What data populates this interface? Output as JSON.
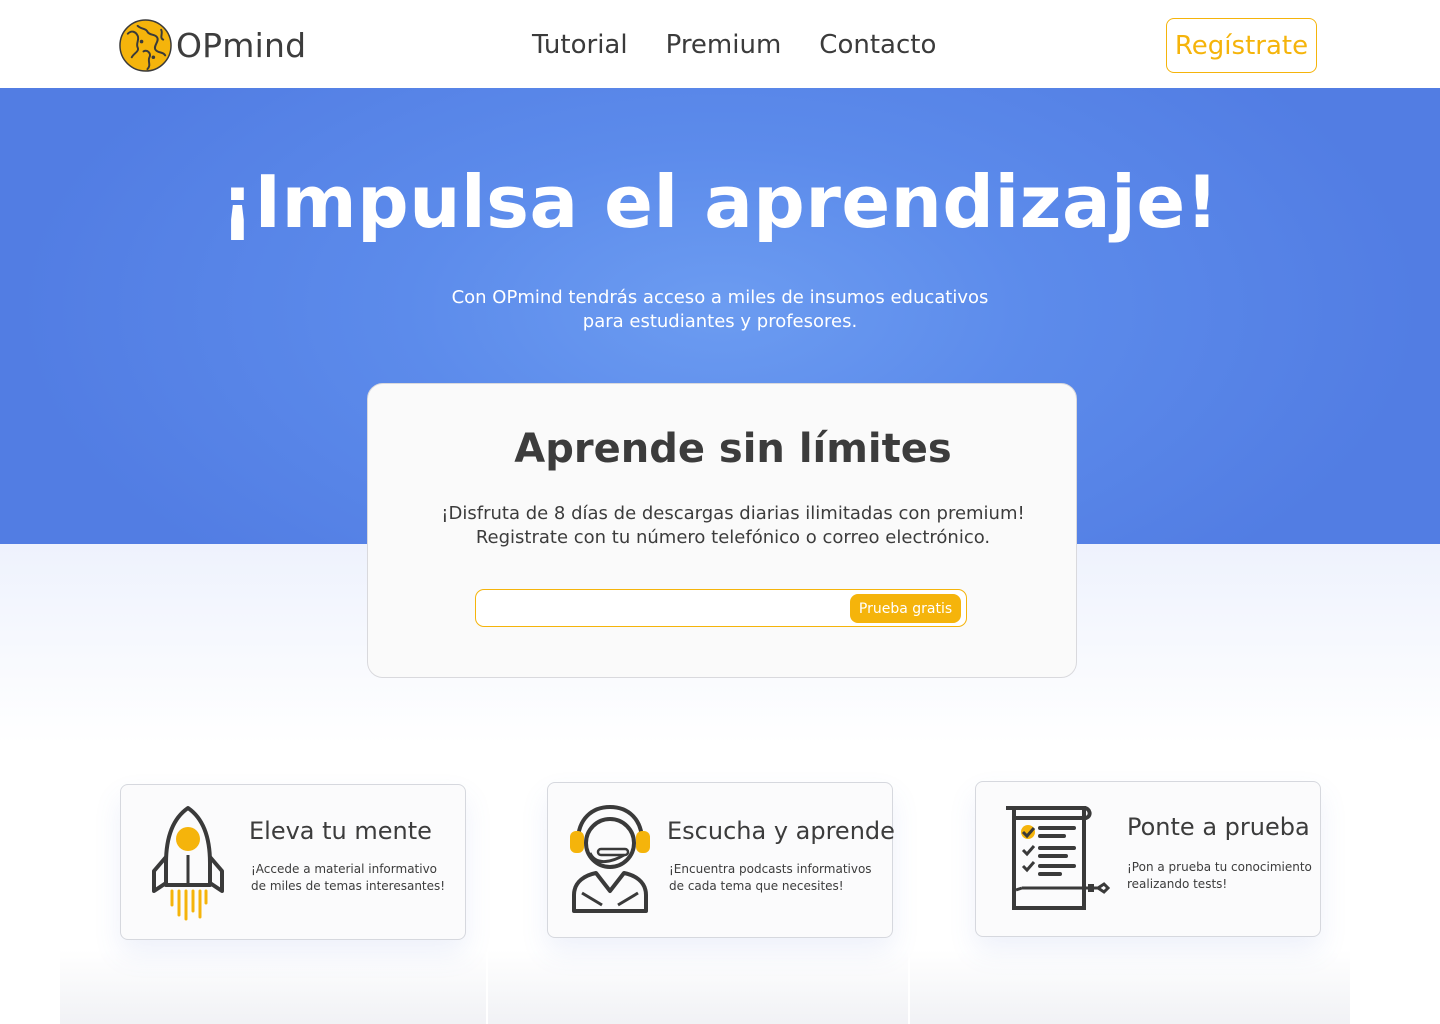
{
  "brand": {
    "name": "OPmind",
    "logo_icon": "globe-icon",
    "accent": "#f5b40b"
  },
  "nav": {
    "items": [
      {
        "label": "Tutorial"
      },
      {
        "label": "Premium"
      },
      {
        "label": "Contacto"
      }
    ],
    "register_label": "Regístrate"
  },
  "hero": {
    "title": "¡Impulsa el aprendizaje!",
    "subtitle": "Con OPmind tendrás acceso a miles de insumos educativos para estudiantes y profesores.",
    "gradient": [
      "#6c9cf1",
      "#527de3"
    ]
  },
  "signup": {
    "title": "Aprende sin límites",
    "line1": "¡Disfruta de 8 días de descargas diarias ilimitadas con premium!",
    "line2": "Registrate con tu número telefónico o correo electrónico.",
    "input_value": "",
    "button_label": "Prueba gratis"
  },
  "features": [
    {
      "icon": "rocket-icon",
      "title": "Eleva tu mente",
      "text": "¡Accede a material informativo de miles de temas interesantes!"
    },
    {
      "icon": "headset-person-icon",
      "title": "Escucha y aprende",
      "text": "¡Encuentra podcasts informativos de cada tema que necesites!"
    },
    {
      "icon": "checklist-scroll-icon",
      "title": "Ponte a prueba",
      "text": "¡Pon a prueba tu conocimiento realizando tests!"
    }
  ]
}
